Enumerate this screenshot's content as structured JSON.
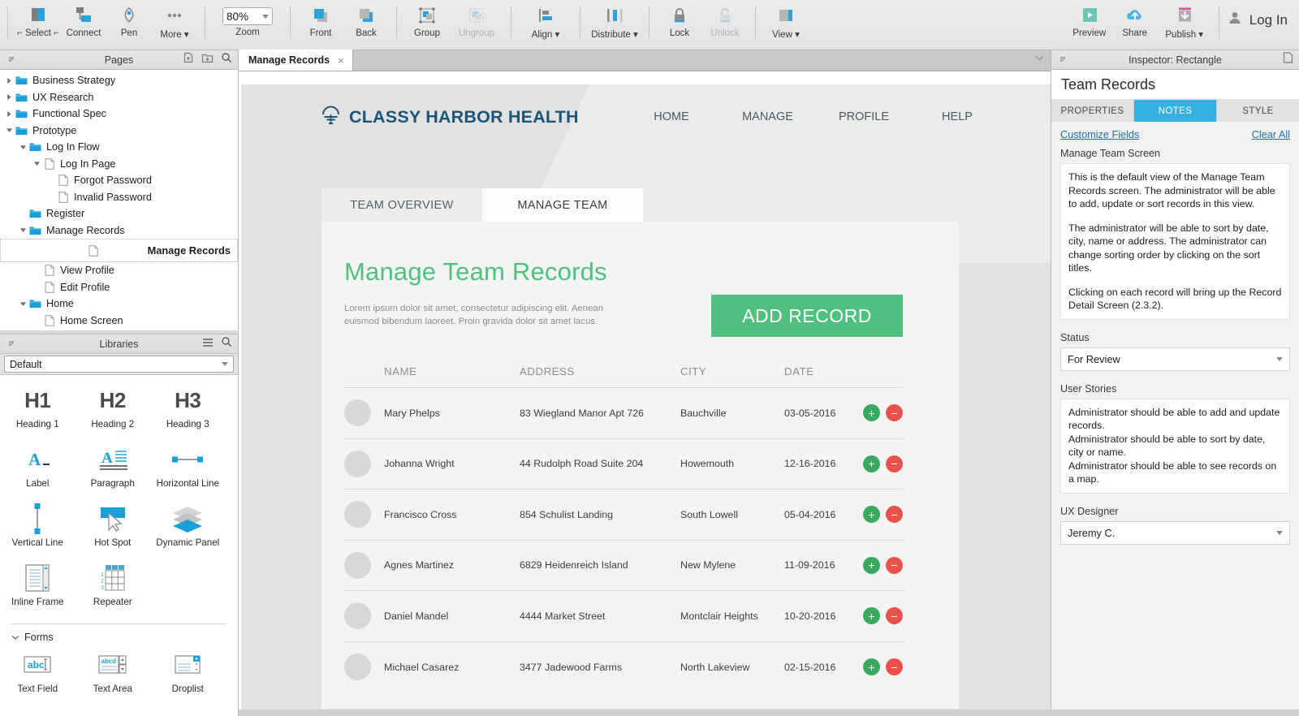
{
  "toolbar": {
    "groups": [
      {
        "items": [
          {
            "name": "select",
            "label": "⌐ Select ⌐",
            "icon": "select-icon",
            "disabled": false
          },
          {
            "name": "connect",
            "label": "Connect",
            "icon": "connect-icon",
            "disabled": false
          },
          {
            "name": "pen",
            "label": "Pen",
            "icon": "pen-icon",
            "disabled": false
          },
          {
            "name": "more",
            "label": "More ▾",
            "icon": "more-dots-icon",
            "disabled": false
          }
        ]
      },
      {
        "items": [
          {
            "name": "front",
            "label": "Front",
            "icon": "bring-front-icon",
            "disabled": false
          },
          {
            "name": "back",
            "label": "Back",
            "icon": "send-back-icon",
            "disabled": false
          }
        ]
      },
      {
        "items": [
          {
            "name": "group",
            "label": "Group",
            "icon": "group-icon",
            "disabled": false
          },
          {
            "name": "ungroup",
            "label": "Ungroup",
            "icon": "ungroup-icon",
            "disabled": true
          }
        ]
      },
      {
        "items": [
          {
            "name": "align",
            "label": "Align ▾",
            "icon": "align-icon",
            "disabled": false
          }
        ]
      },
      {
        "items": [
          {
            "name": "distribute",
            "label": "Distribute ▾",
            "icon": "distribute-icon",
            "disabled": false
          }
        ]
      },
      {
        "items": [
          {
            "name": "lock",
            "label": "Lock",
            "icon": "lock-icon",
            "disabled": false
          },
          {
            "name": "unlock",
            "label": "Unlock",
            "icon": "unlock-icon",
            "disabled": true
          }
        ]
      },
      {
        "items": [
          {
            "name": "view",
            "label": "View ▾",
            "icon": "view-icon",
            "disabled": false
          }
        ]
      }
    ],
    "zoom": {
      "value": "80%",
      "label": "Zoom"
    },
    "right": [
      {
        "name": "preview",
        "label": "Preview",
        "icon": "play-icon"
      },
      {
        "name": "share",
        "label": "Share",
        "icon": "cloud-upload-icon"
      },
      {
        "name": "publish",
        "label": "Publish ▾",
        "icon": "publish-download-icon"
      }
    ],
    "login_label": "Log In"
  },
  "pages_panel": {
    "title": "Pages",
    "tree": [
      {
        "label": "Business Strategy",
        "depth": 0,
        "type": "folder",
        "twisty": "right",
        "selected": false
      },
      {
        "label": "UX Research",
        "depth": 0,
        "type": "folder",
        "twisty": "right",
        "selected": false
      },
      {
        "label": "Functional Spec",
        "depth": 0,
        "type": "folder",
        "twisty": "right",
        "selected": false
      },
      {
        "label": "Prototype",
        "depth": 0,
        "type": "folder",
        "twisty": "down",
        "selected": false
      },
      {
        "label": "Log In Flow",
        "depth": 1,
        "type": "folder",
        "twisty": "down",
        "selected": false
      },
      {
        "label": "Log In Page",
        "depth": 2,
        "type": "page",
        "twisty": "down",
        "selected": false
      },
      {
        "label": "Forgot Password",
        "depth": 3,
        "type": "page",
        "twisty": "none",
        "selected": false
      },
      {
        "label": "Invalid Password",
        "depth": 3,
        "type": "page",
        "twisty": "none",
        "selected": false
      },
      {
        "label": "Register",
        "depth": 1,
        "type": "folder",
        "twisty": "none",
        "selected": false
      },
      {
        "label": "Manage Records",
        "depth": 1,
        "type": "folder",
        "twisty": "down",
        "selected": false
      },
      {
        "label": "Manage Records",
        "depth": 2,
        "type": "page",
        "twisty": "none",
        "selected": true
      },
      {
        "label": "View Profile",
        "depth": 2,
        "type": "page",
        "twisty": "none",
        "selected": false
      },
      {
        "label": "Edit Profile",
        "depth": 2,
        "type": "page",
        "twisty": "none",
        "selected": false
      },
      {
        "label": "Home",
        "depth": 1,
        "type": "folder",
        "twisty": "down",
        "selected": false
      },
      {
        "label": "Home Screen",
        "depth": 2,
        "type": "page",
        "twisty": "none",
        "selected": false
      }
    ]
  },
  "libraries_panel": {
    "title": "Libraries",
    "selected_library": "Default",
    "widgets": [
      {
        "label": "Heading 1",
        "icon": "h1-icon",
        "glyph": "H1"
      },
      {
        "label": "Heading 2",
        "icon": "h2-icon",
        "glyph": "H2"
      },
      {
        "label": "Heading 3",
        "icon": "h3-icon",
        "glyph": "H3"
      },
      {
        "label": "Label",
        "icon": "label-icon",
        "glyph": ""
      },
      {
        "label": "Paragraph",
        "icon": "paragraph-icon",
        "glyph": ""
      },
      {
        "label": "Horizontal Line",
        "icon": "horizontal-line-icon",
        "glyph": ""
      },
      {
        "label": "Vertical Line",
        "icon": "vertical-line-icon",
        "glyph": ""
      },
      {
        "label": "Hot Spot",
        "icon": "hot-spot-icon",
        "glyph": ""
      },
      {
        "label": "Dynamic Panel",
        "icon": "dynamic-panel-icon",
        "glyph": ""
      },
      {
        "label": "Inline Frame",
        "icon": "inline-frame-icon",
        "glyph": ""
      },
      {
        "label": "Repeater",
        "icon": "repeater-icon",
        "glyph": ""
      }
    ],
    "section_forms": "Forms",
    "form_widgets": [
      {
        "label": "Text Field",
        "icon": "text-field-icon"
      },
      {
        "label": "Text Area",
        "icon": "text-area-icon"
      },
      {
        "label": "Droplist",
        "icon": "droplist-icon"
      }
    ]
  },
  "canvas": {
    "tab": {
      "label": "Manage Records",
      "close": "×"
    },
    "site": {
      "brand": "CLASSY HARBOR HEALTH",
      "brand_icon": "harbor-lamp-icon",
      "nav": [
        {
          "label": "HOME"
        },
        {
          "label": "MANAGE"
        },
        {
          "label": "PROFILE"
        },
        {
          "label": "HELP"
        }
      ],
      "tabs": [
        {
          "label": "TEAM OVERVIEW",
          "active": false
        },
        {
          "label": "MANAGE TEAM",
          "active": true
        }
      ],
      "heading": "Manage Team Records",
      "subtext": "Lorem ipsum dolor sit amet, consectetur adipiscing elit. Aenean euismod bibendum laoreet. Proin gravida dolor sit amet lacus.",
      "add_button": "ADD RECORD",
      "columns": [
        "NAME",
        "ADDRESS",
        "CITY",
        "DATE"
      ],
      "rows": [
        {
          "name": "Mary Phelps",
          "address": "83 Wiegland Manor Apt 726",
          "city": "Bauchville",
          "date": "03-05-2016"
        },
        {
          "name": "Johanna Wright",
          "address": "44 Rudolph Road Suite 204",
          "city": "Howemouth",
          "date": "12-16-2016"
        },
        {
          "name": "Francisco Cross",
          "address": "854 Schulist Landing",
          "city": "South Lowell",
          "date": "05-04-2016"
        },
        {
          "name": "Agnes Martinez",
          "address": "6829 Heidenreich Island",
          "city": "New Mylene",
          "date": "11-09-2016"
        },
        {
          "name": "Daniel Mandel",
          "address": "4444 Market Street",
          "city": "Montclair Heights",
          "date": "10-20-2016"
        },
        {
          "name": "Michael Casarez",
          "address": "3477 Jadewood Farms",
          "city": "North Lakeview",
          "date": "02-15-2016"
        }
      ],
      "row_add_label": "+",
      "row_remove_label": "−"
    }
  },
  "inspector": {
    "header": "Inspector: Rectangle",
    "object_name": "Team Records",
    "tabs": [
      {
        "label": "PROPERTIES",
        "active": false
      },
      {
        "label": "NOTES",
        "active": true
      },
      {
        "label": "STYLE",
        "active": false
      }
    ],
    "customize_fields": "Customize Fields",
    "clear_all": "Clear All",
    "note_field_label": "Manage Team Screen",
    "note_p1": "This is the default view of the Manage Team Records screen. The administrator will be able to add, update or sort records in this view.",
    "note_p2": "The administrator will be able to sort by date, city, name or address. The administrator can change sorting order by clicking on the sort titles.",
    "note_p3": "Clicking on each record will bring up the Record Detail Screen (2.3.2).",
    "status_label": "Status",
    "status_value": "For Review",
    "user_stories_label": "User Stories",
    "user_stories": "Administrator should be able to add and update records.\nAdministrator should be able to sort by date, city or name.\nAdministrator should be able to see records on a map.",
    "ux_designer_label": "UX Designer",
    "ux_designer_value": "Jeremy C."
  },
  "colors": {
    "accent_green": "#4fc07e",
    "brand_blue": "#1b5578",
    "tab_active_blue": "#36b0e0",
    "row_add_green": "#3aa85e",
    "row_remove_red": "#e8524a",
    "toolbar_blue": "#2aa3dc"
  }
}
